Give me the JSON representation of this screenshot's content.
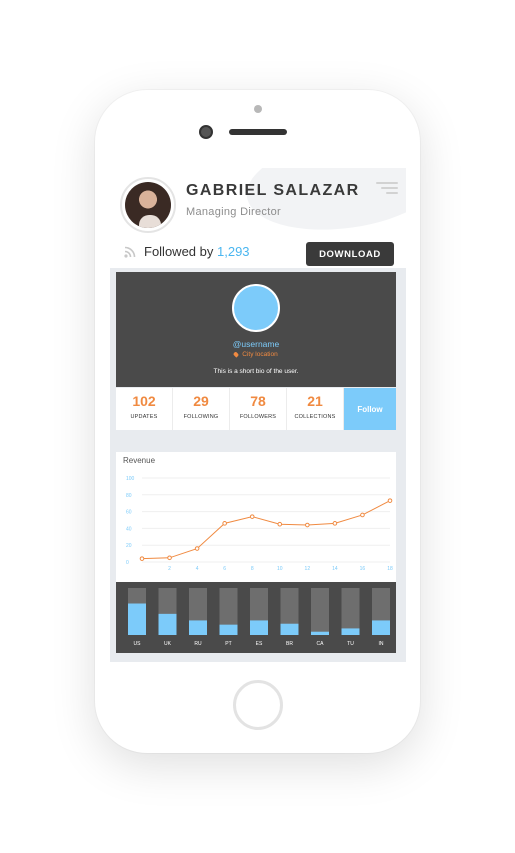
{
  "profile": {
    "name": "GABRIEL SALAZAR",
    "title": "Managing Director",
    "followed_label": "Followed by",
    "followed_count": "1,293",
    "download_label": "DOWNLOAD"
  },
  "card": {
    "username": "@username",
    "location": "City location",
    "bio": "This is a short bio of the user."
  },
  "stats": [
    {
      "value": "102",
      "label": "UPDATES"
    },
    {
      "value": "29",
      "label": "FOLLOWING"
    },
    {
      "value": "78",
      "label": "FOLLOWERS"
    },
    {
      "value": "21",
      "label": "COLLECTIONS"
    }
  ],
  "follow_label": "Follow",
  "colors": {
    "accent_blue": "#7ccbfa",
    "accent_orange": "#f08a41",
    "dark": "#4a4a4a"
  },
  "icons": [
    "menu-icon",
    "rss-icon",
    "pin-icon"
  ],
  "chart_data": [
    {
      "type": "line",
      "title": "Revenue",
      "xlabel": "",
      "ylabel": "",
      "x_ticks": [
        2,
        4,
        6,
        8,
        10,
        12,
        14,
        16,
        18
      ],
      "y_ticks": [
        0,
        20,
        40,
        60,
        80,
        100
      ],
      "ylim": [
        0,
        100
      ],
      "xlim": [
        0,
        18
      ],
      "grid": true,
      "x": [
        0,
        2,
        4,
        6,
        8,
        10,
        12,
        14,
        16,
        18
      ],
      "y": [
        4,
        5,
        16,
        46,
        54,
        45,
        44,
        46,
        56,
        73
      ]
    },
    {
      "type": "bar",
      "categories": [
        "US",
        "UK",
        "RU",
        "PT",
        "ES",
        "BR",
        "CA",
        "TU",
        "IN"
      ],
      "values": [
        67,
        45,
        31,
        22,
        31,
        24,
        7,
        14,
        31
      ],
      "ylim": [
        0,
        100
      ]
    }
  ]
}
